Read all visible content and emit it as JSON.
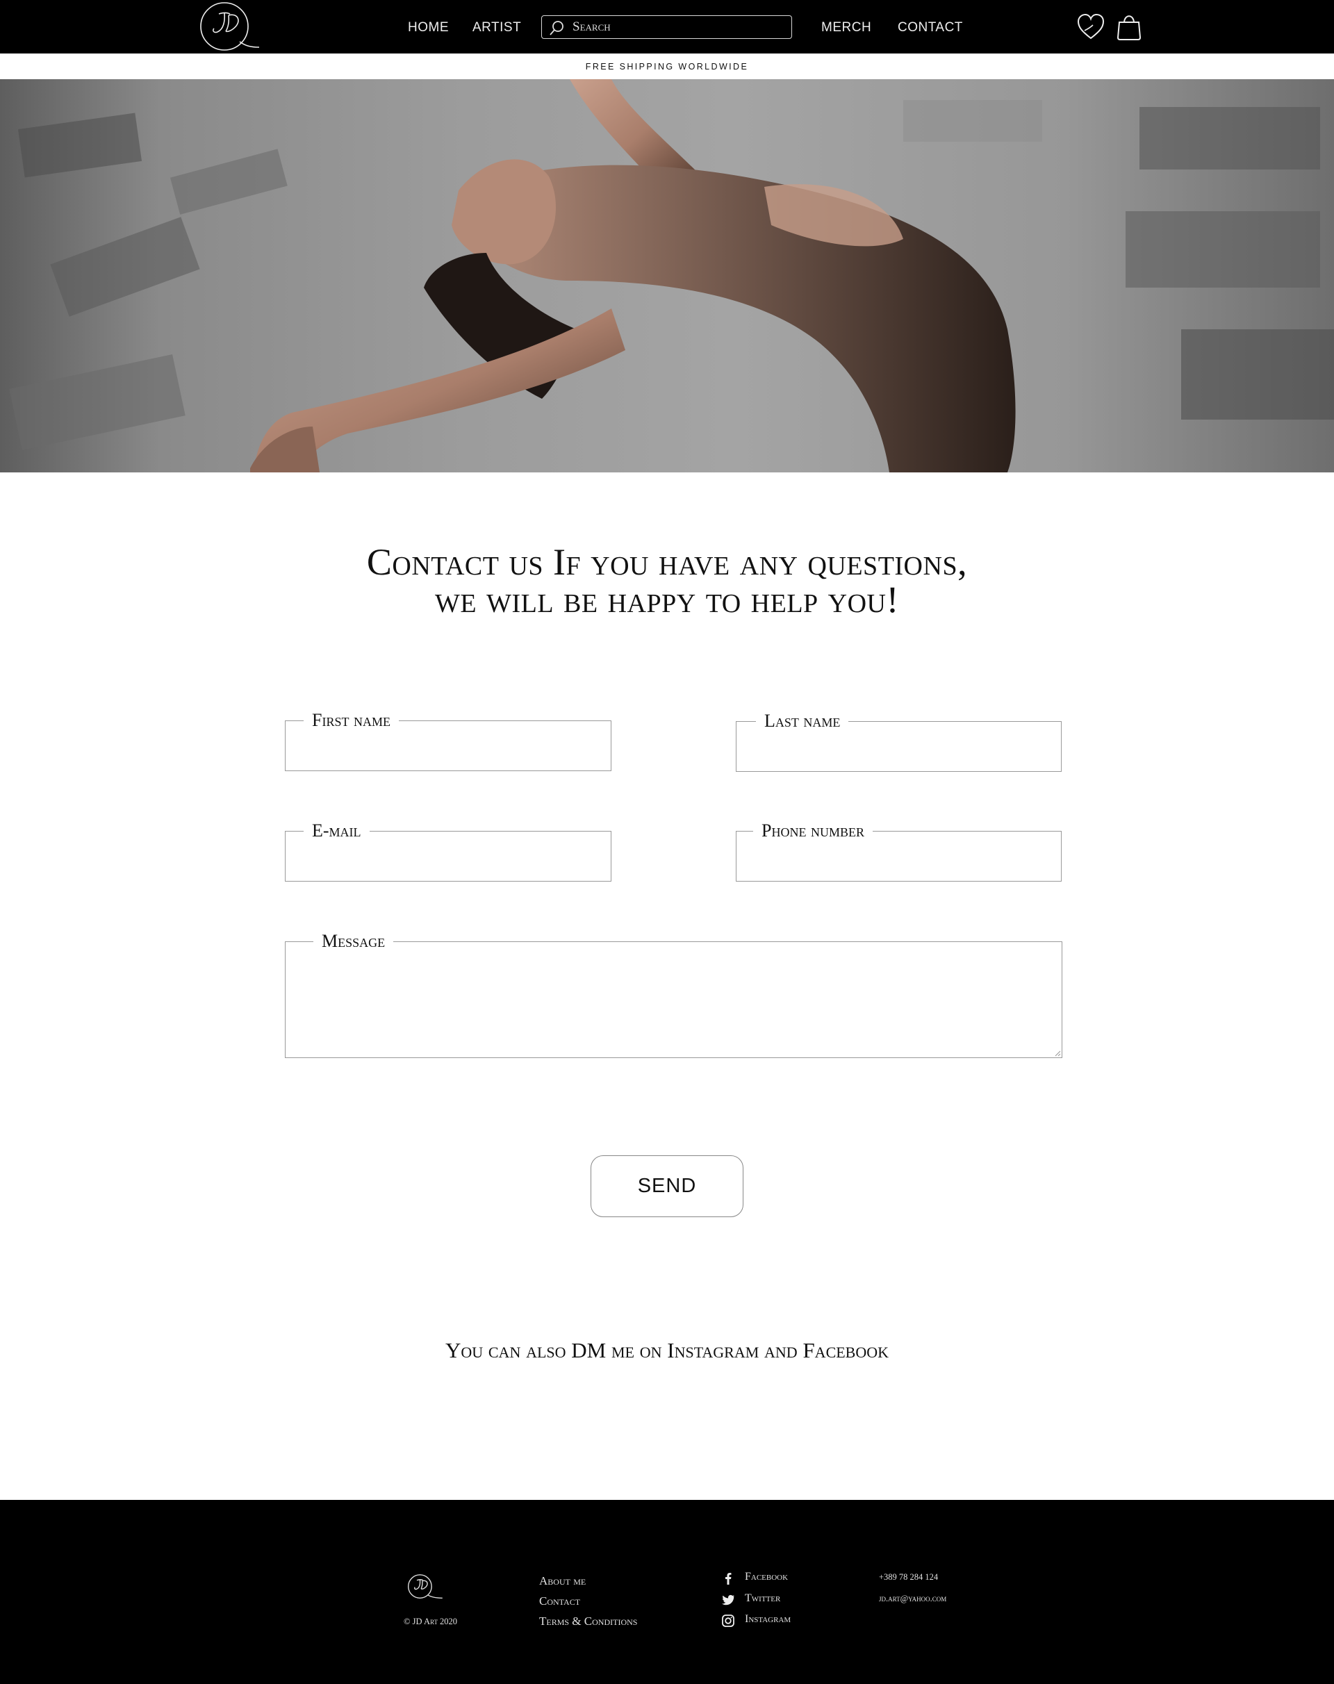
{
  "header": {
    "nav": [
      "HOME",
      "ARTIST",
      "MERCH",
      "CONTACT"
    ],
    "search_placeholder": "Search"
  },
  "announcement": "FREE SHIPPING WORLDWIDE",
  "contact": {
    "heading_line1": "Contact us If you have any questions,",
    "heading_line2": "we will be happy to help you!",
    "form": {
      "first_name_label": "First name",
      "last_name_label": "Last name",
      "email_label": "E-mail",
      "phone_label": "Phone number",
      "message_label": "Message",
      "first_name_value": "",
      "last_name_value": "",
      "email_value": "",
      "phone_value": "",
      "message_value": "",
      "send_label": "SEND"
    },
    "dm_note": "You can also DM me on Instagram and Facebook"
  },
  "footer": {
    "copyright": "© JD Art 2020",
    "links": [
      "About me",
      "Contact",
      "Terms & Conditions"
    ],
    "social": [
      {
        "label": "Facebook",
        "icon": "facebook-icon"
      },
      {
        "label": "Twitter",
        "icon": "twitter-icon"
      },
      {
        "label": "Instagram",
        "icon": "instagram-icon"
      }
    ],
    "phone": "+389 78 284 124",
    "email": "jd.art@yahoo.com"
  }
}
